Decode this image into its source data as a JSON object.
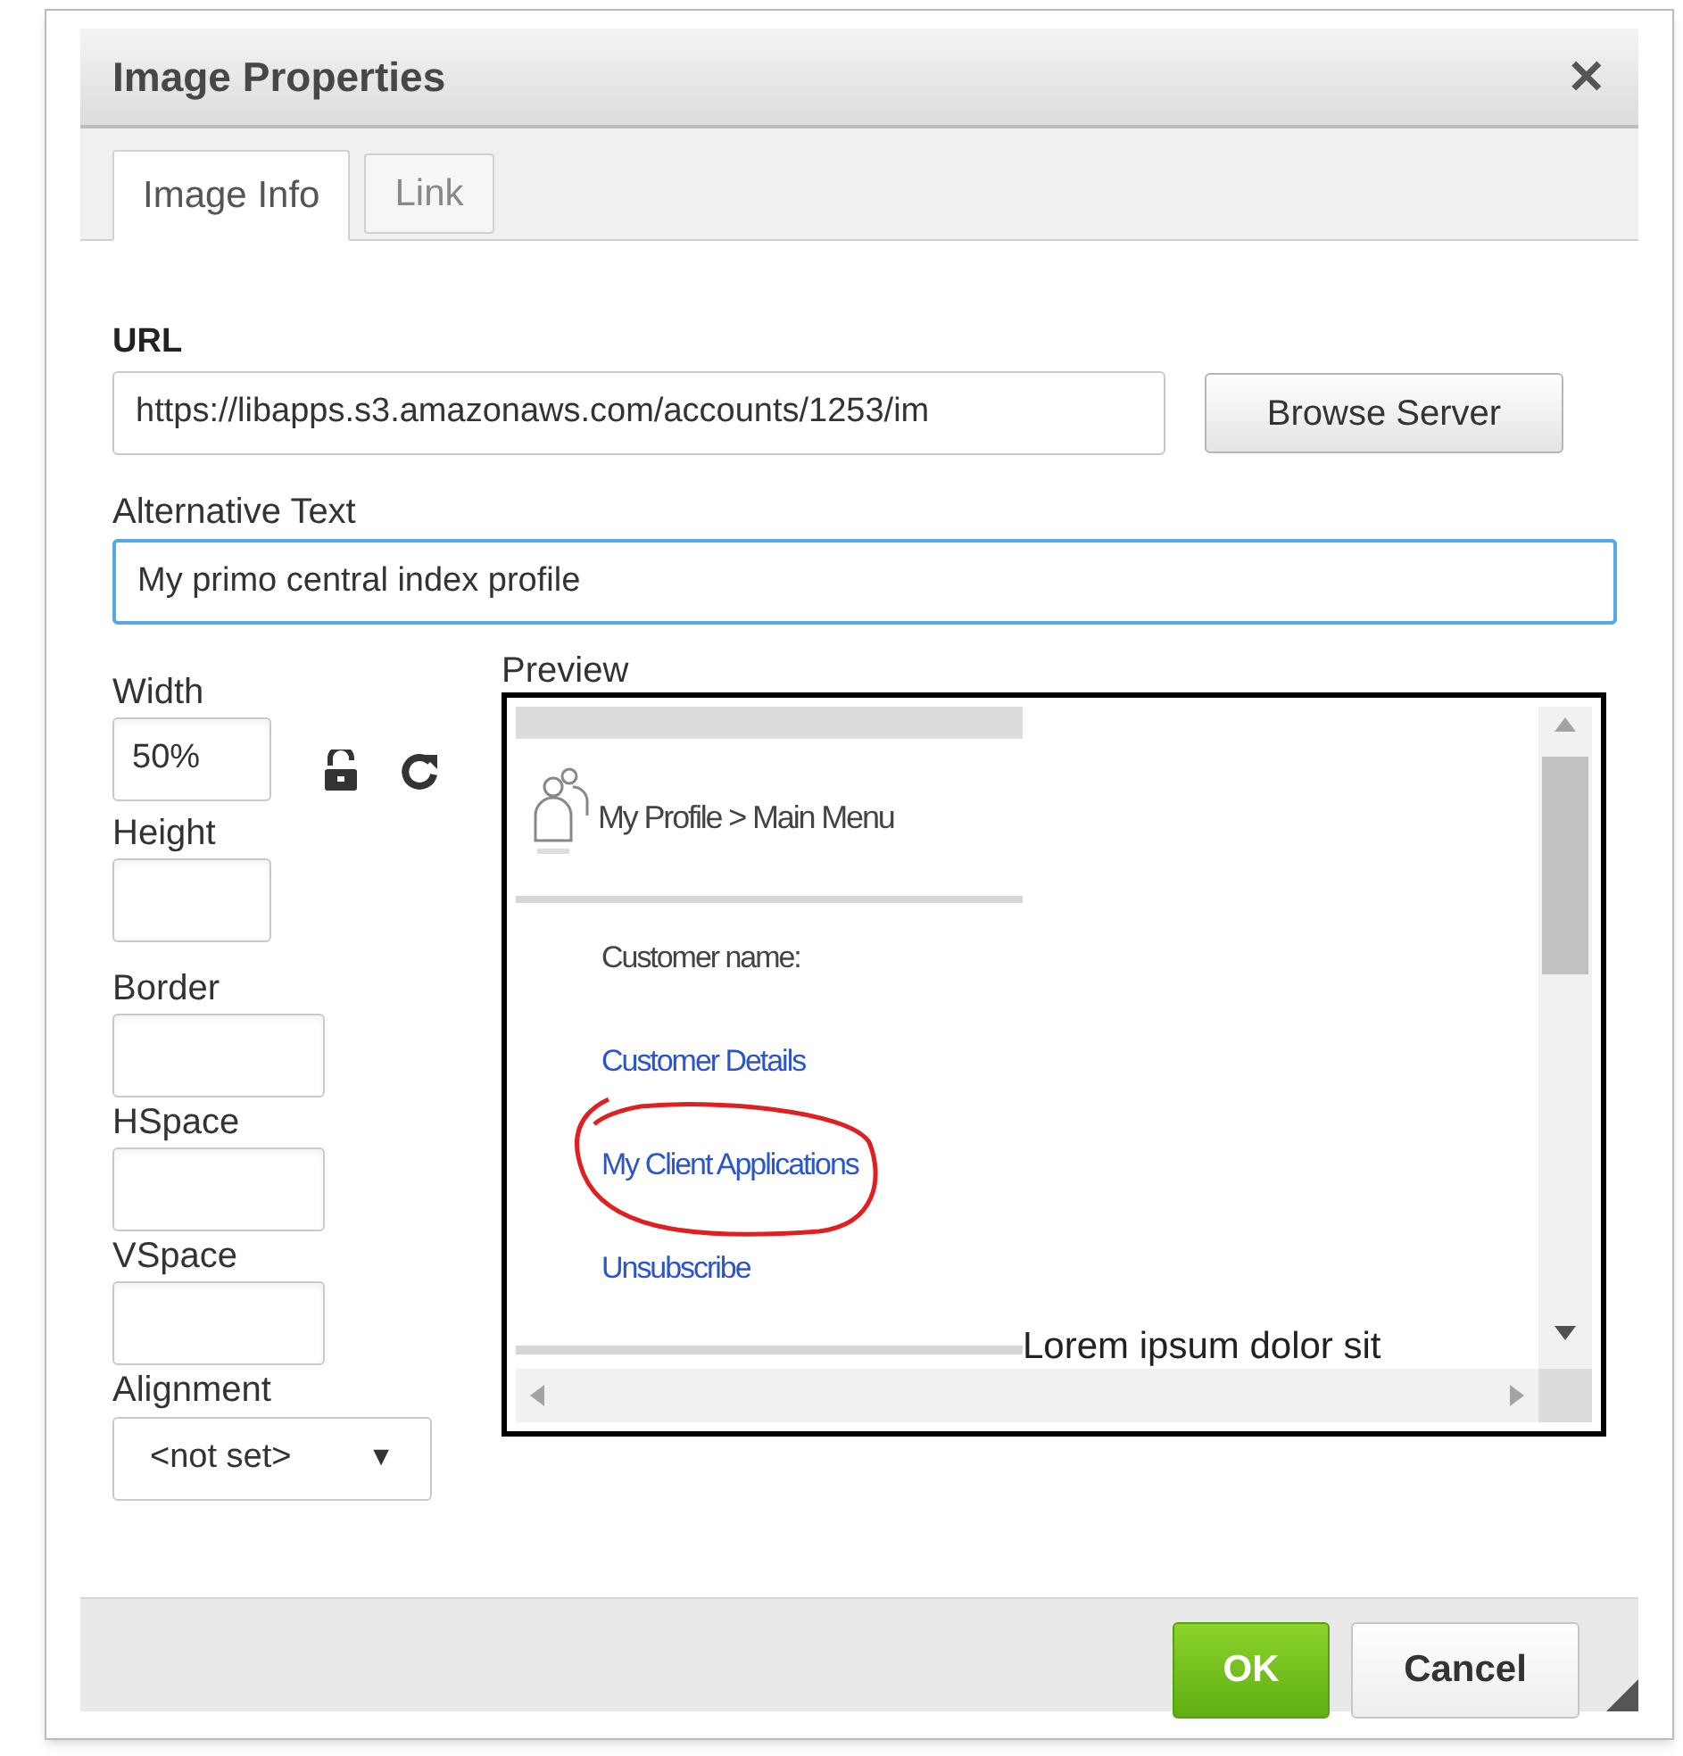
{
  "dialog": {
    "title": "Image Properties",
    "close": "✕"
  },
  "tabs": [
    {
      "label": "Image Info",
      "selected": true
    },
    {
      "label": "Link",
      "selected": false
    }
  ],
  "url": {
    "label": "URL",
    "value": "https://libapps.s3.amazonaws.com/accounts/1253/im"
  },
  "browse_button": "Browse Server",
  "alt_text": {
    "label": "Alternative Text",
    "value": "My primo central index profile",
    "focused": true
  },
  "size_fields": [
    {
      "label": "Width",
      "value": "50%"
    },
    {
      "label": "Height"
    }
  ],
  "ratio_locked": false,
  "spacing_fields": [
    {
      "label": "Border"
    },
    {
      "label": "HSpace"
    },
    {
      "label": "VSpace"
    }
  ],
  "alignment": {
    "label": "Alignment",
    "value": "<not set>",
    "arrow": "▼"
  },
  "preview": {
    "label": "Preview",
    "breadcrumb": "My Profile > Main Menu",
    "items": [
      {
        "kind": "label",
        "text": "Customer name:",
        "circled": false
      },
      {
        "kind": "link",
        "text": "Customer Details",
        "circled": false
      },
      {
        "kind": "link",
        "text": "My Client Applications",
        "circled": true
      },
      {
        "kind": "link",
        "text": "Unsubscribe",
        "circled": false
      }
    ],
    "caption": "Lorem ipsum dolor sit"
  },
  "buttons": [
    {
      "kind": "primary",
      "label": "OK"
    },
    {
      "kind": "secondary",
      "label": "Cancel"
    }
  ]
}
